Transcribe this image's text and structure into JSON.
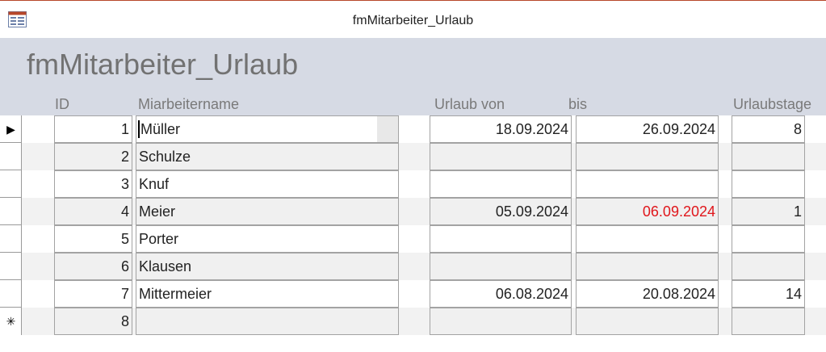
{
  "window": {
    "title": "fmMitarbeiter_Urlaub"
  },
  "form": {
    "title": "fmMitarbeiter_Urlaub"
  },
  "columns": {
    "id": "ID",
    "name": "Miarbeitername",
    "from": "Urlaub von",
    "to": "bis",
    "days": "Urlaubstage"
  },
  "rows": [
    {
      "selector": "current",
      "id": "1",
      "name": "Müller",
      "from": "18.09.2024",
      "to": "26.09.2024",
      "days": "8"
    },
    {
      "selector": "",
      "id": "2",
      "name": "Schulze",
      "from": "",
      "to": "",
      "days": ""
    },
    {
      "selector": "",
      "id": "3",
      "name": "Knuf",
      "from": "",
      "to": "",
      "days": ""
    },
    {
      "selector": "",
      "id": "4",
      "name": "Meier",
      "from": "05.09.2024",
      "to": "06.09.2024",
      "days": "1",
      "to_color": "#e0161b"
    },
    {
      "selector": "",
      "id": "5",
      "name": "Porter",
      "from": "",
      "to": "",
      "days": ""
    },
    {
      "selector": "",
      "id": "6",
      "name": "Klausen",
      "from": "",
      "to": "",
      "days": ""
    },
    {
      "selector": "",
      "id": "7",
      "name": "Mittermeier",
      "from": "06.08.2024",
      "to": "20.08.2024",
      "days": "14"
    },
    {
      "selector": "new",
      "id": "8",
      "name": "",
      "from": "",
      "to": "",
      "days": ""
    }
  ],
  "glyphs": {
    "current": "▶",
    "new": "✳"
  },
  "colors": {
    "header_bg": "#d6dae4",
    "alt_row_bg": "#f2f2f2",
    "warning_date": "#e0161b"
  }
}
